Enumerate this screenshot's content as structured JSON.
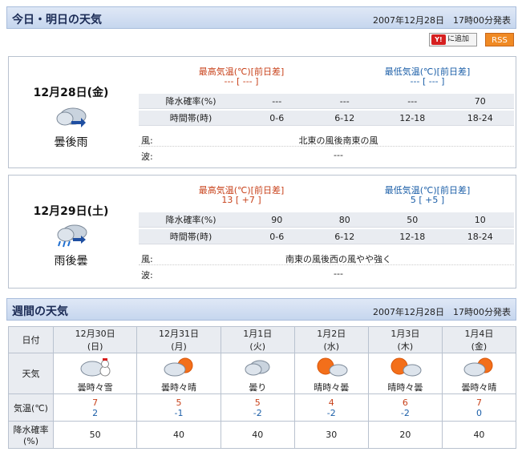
{
  "today": {
    "header_title": "今日・明日の天気",
    "header_date": "2007年12月28日　17時00分発表",
    "tools": {
      "add_label": "に追加",
      "rss_label": "RSS"
    },
    "days": [
      {
        "date": "12月28日(金)",
        "condition": "曇後雨",
        "icon": "cloud-rain-icon",
        "hi_label": "最高気温(℃)[前日差]",
        "hi_value": "--- [ --- ]",
        "lo_label": "最低気温(℃)[前日差]",
        "lo_value": "--- [ --- ]",
        "precip_label": "降水確率(%)",
        "precip": [
          "---",
          "---",
          "---",
          "70"
        ],
        "period_label": "時間帯(時)",
        "periods": [
          "0-6",
          "6-12",
          "12-18",
          "18-24"
        ],
        "wind_label": "風:",
        "wind": "北東の風後南東の風",
        "wave_label": "波:",
        "wave": "---"
      },
      {
        "date": "12月29日(土)",
        "condition": "雨後曇",
        "icon": "rain-cloud-icon",
        "hi_label": "最高気温(℃)[前日差]",
        "hi_value": "13 [ +7 ]",
        "lo_label": "最低気温(℃)[前日差]",
        "lo_value": "5 [ +5 ]",
        "precip_label": "降水確率(%)",
        "precip": [
          "90",
          "80",
          "50",
          "10"
        ],
        "period_label": "時間帯(時)",
        "periods": [
          "0-6",
          "6-12",
          "12-18",
          "18-24"
        ],
        "wind_label": "風:",
        "wind": "南東の風後西の風やや強く",
        "wave_label": "波:",
        "wave": "---"
      }
    ]
  },
  "weekly": {
    "header_title": "週間の天気",
    "header_date": "2007年12月28日　17時00分発表",
    "row_labels": {
      "date": "日付",
      "weather": "天気",
      "temp": "気温(℃)",
      "precip": "降水確率(%)"
    },
    "days": [
      {
        "date": "12月30日",
        "dow": "(日)",
        "cond": "曇時々雪",
        "icon": "cloud-snow-icon",
        "hi": "7",
        "lo": "2",
        "precip": "50"
      },
      {
        "date": "12月31日",
        "dow": "(月)",
        "cond": "曇時々晴",
        "icon": "cloud-sun-icon",
        "hi": "5",
        "lo": "-1",
        "precip": "40"
      },
      {
        "date": "1月1日",
        "dow": "(火)",
        "cond": "曇り",
        "icon": "cloud-icon",
        "hi": "5",
        "lo": "-2",
        "precip": "40"
      },
      {
        "date": "1月2日",
        "dow": "(水)",
        "cond": "晴時々曇",
        "icon": "sun-cloud-icon",
        "hi": "4",
        "lo": "-2",
        "precip": "30"
      },
      {
        "date": "1月3日",
        "dow": "(木)",
        "cond": "晴時々曇",
        "icon": "sun-cloud-icon",
        "hi": "6",
        "lo": "-2",
        "precip": "20"
      },
      {
        "date": "1月4日",
        "dow": "(金)",
        "cond": "曇時々晴",
        "icon": "cloud-sun-icon",
        "hi": "7",
        "lo": "0",
        "precip": "40"
      }
    ]
  },
  "colors": {
    "hi": "#c8421b",
    "lo": "#1c5fa8",
    "header_bg": "#c6d6ee",
    "shade": "#e9ecf1"
  }
}
